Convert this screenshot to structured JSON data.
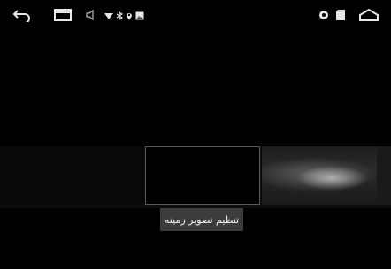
{
  "status_bar": {
    "icons": [
      "back-icon",
      "recent-apps-icon",
      "volume-icon",
      "wifi-icon",
      "bluetooth-icon",
      "location-icon",
      "gallery-icon",
      "settings-icon",
      "sd-card-icon",
      "home-icon"
    ]
  },
  "wallpaper_picker": {
    "label": "تنظیم تصویر زمینه"
  }
}
